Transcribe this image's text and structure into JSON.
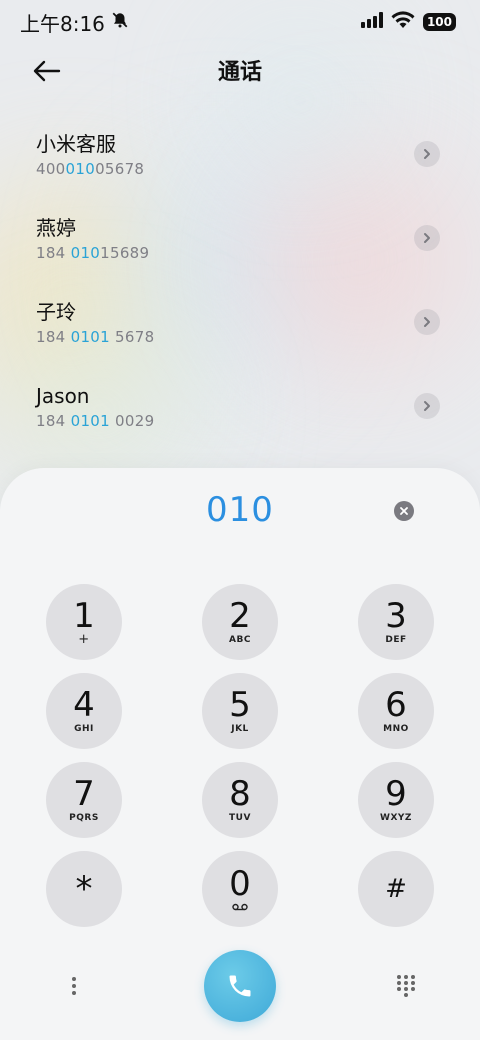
{
  "status_bar": {
    "time": "上午8:16",
    "battery": "100"
  },
  "header": {
    "title": "通话"
  },
  "contacts": [
    {
      "name": "小米客服",
      "number_pre": "400",
      "number_hl": "010",
      "number_post": "05678"
    },
    {
      "name": "燕婷",
      "number_pre": "184 ",
      "number_hl": "010",
      "number_post": "15689"
    },
    {
      "name": "子玲",
      "number_pre": "184 ",
      "number_hl": "0101",
      "number_post": " 5678"
    },
    {
      "name": "Jason",
      "number_pre": "184 ",
      "number_hl": "0101",
      "number_post": " 0029"
    }
  ],
  "dialer": {
    "input": "010",
    "keys": [
      {
        "digit": "1",
        "letters": "+"
      },
      {
        "digit": "2",
        "letters": "ABC"
      },
      {
        "digit": "3",
        "letters": "DEF"
      },
      {
        "digit": "4",
        "letters": "GHI"
      },
      {
        "digit": "5",
        "letters": "JKL"
      },
      {
        "digit": "6",
        "letters": "MNO"
      },
      {
        "digit": "7",
        "letters": "PQRS"
      },
      {
        "digit": "8",
        "letters": "TUV"
      },
      {
        "digit": "9",
        "letters": "WXYZ"
      },
      {
        "digit": "*",
        "letters": ""
      },
      {
        "digit": "0",
        "letters": ""
      },
      {
        "digit": "#",
        "letters": ""
      }
    ]
  },
  "icons": {
    "mute": "bell-off-icon",
    "signal": "signal-icon",
    "wifi": "wifi-icon",
    "back": "arrow-left-icon",
    "chevron": "chevron-right-icon",
    "clear": "close-icon",
    "voicemail": "voicemail-icon",
    "menu": "more-vertical-icon",
    "call": "phone-icon",
    "keypad": "dialpad-icon"
  },
  "colors": {
    "accent": "#2b8fe0",
    "highlight": "#2aa3d6",
    "call_button": "#3fa9d8"
  }
}
